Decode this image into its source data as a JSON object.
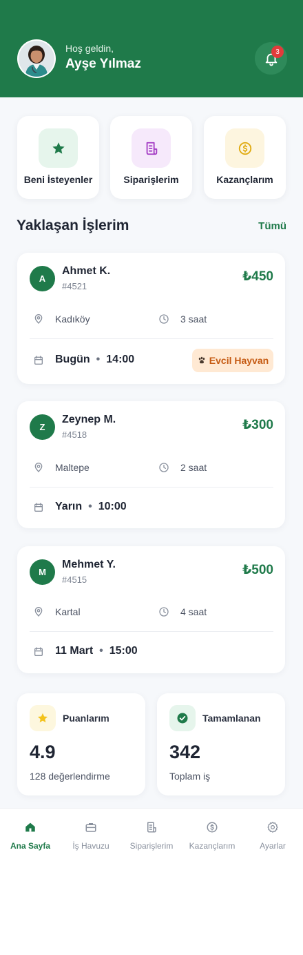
{
  "header": {
    "greeting": "Hoş geldin,",
    "user_name": "Ayşe Yılmaz",
    "notification_count": "3",
    "brand_color": "#1f7a4a"
  },
  "quick_actions": [
    {
      "label": "Beni İsteyenler",
      "icon": "star-icon"
    },
    {
      "label": "Siparişlerim",
      "icon": "receipt-icon"
    },
    {
      "label": "Kazançlarım",
      "icon": "coin-icon"
    }
  ],
  "upcoming": {
    "title": "Yaklaşan İşlerim",
    "see_all": "Tümü",
    "jobs": [
      {
        "initial": "A",
        "name": "Ahmet K.",
        "number": "#4521",
        "price": "₺450",
        "location": "Kadıköy",
        "duration": "3 saat",
        "day": "Bugün",
        "time": "14:00",
        "tag": "Evcil Hayvan"
      },
      {
        "initial": "Z",
        "name": "Zeynep M.",
        "number": "#4518",
        "price": "₺300",
        "location": "Maltepe",
        "duration": "2 saat",
        "day": "Yarın",
        "time": "10:00"
      },
      {
        "initial": "M",
        "name": "Mehmet Y.",
        "number": "#4515",
        "price": "₺500",
        "location": "Kartal",
        "duration": "4 saat",
        "day": "11 Mart",
        "time": "15:00"
      }
    ]
  },
  "stats": [
    {
      "label": "Puanlarım",
      "value": "4.9",
      "sub": "128 değerlendirme",
      "icon": "star-icon"
    },
    {
      "label": "Tamamlanan",
      "value": "342",
      "sub": "Toplam iş",
      "icon": "check-circle-icon"
    }
  ],
  "nav": {
    "items": [
      {
        "label": "Ana Sayfa",
        "icon": "home-icon",
        "active": true
      },
      {
        "label": "İş Havuzu",
        "icon": "briefcase-icon"
      },
      {
        "label": "Siparişlerim",
        "icon": "receipt-icon"
      },
      {
        "label": "Kazançlarım",
        "icon": "coin-icon"
      },
      {
        "label": "Ayarlar",
        "icon": "gear-icon"
      }
    ]
  }
}
